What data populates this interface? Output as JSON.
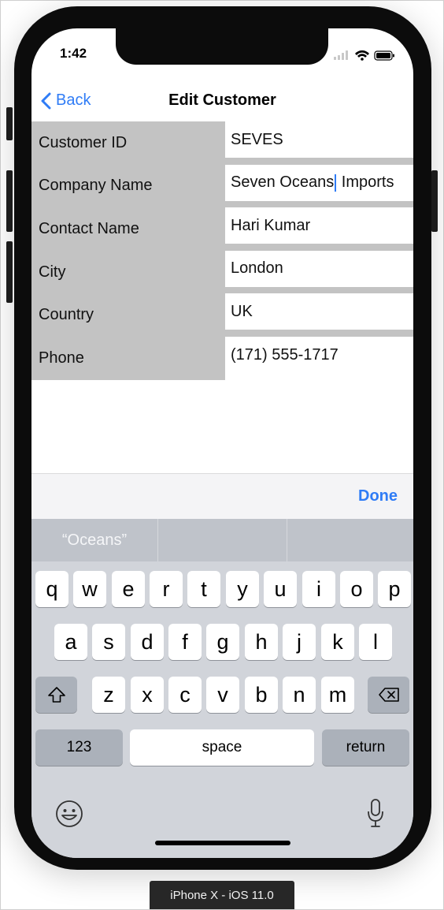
{
  "status_bar": {
    "time": "1:42"
  },
  "nav": {
    "back_label": "Back",
    "title": "Edit Customer"
  },
  "form": {
    "rows": [
      {
        "label": "Customer ID",
        "value": "SEVES"
      },
      {
        "label": "Company Name",
        "value_before_caret": "Seven Oceans",
        "value_after_caret": " Imports"
      },
      {
        "label": "Contact Name",
        "value": "Hari Kumar"
      },
      {
        "label": "City",
        "value": "London"
      },
      {
        "label": "Country",
        "value": "UK"
      },
      {
        "label": "Phone",
        "value": "(171) 555-1717"
      }
    ]
  },
  "toolbar": {
    "done_label": "Done"
  },
  "keyboard": {
    "suggestions": [
      "“Oceans”",
      "",
      ""
    ],
    "row1": [
      "q",
      "w",
      "e",
      "r",
      "t",
      "y",
      "u",
      "i",
      "o",
      "p"
    ],
    "row2": [
      "a",
      "s",
      "d",
      "f",
      "g",
      "h",
      "j",
      "k",
      "l"
    ],
    "row3": [
      "z",
      "x",
      "c",
      "v",
      "b",
      "n",
      "m"
    ],
    "numbers_label": "123",
    "space_label": "space",
    "return_label": "return"
  },
  "simulator_label": "iPhone X - iOS 11.0",
  "colors": {
    "accent": "#2f7cf6",
    "label_bg": "#c3c3c3",
    "keyboard_bg": "#d1d4da"
  }
}
